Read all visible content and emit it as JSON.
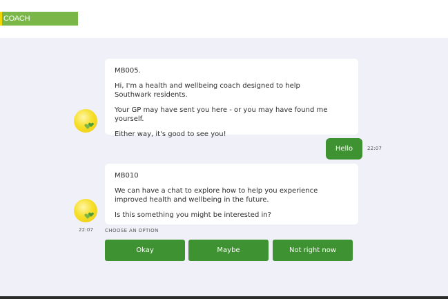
{
  "header": {
    "logo_text": "COACH"
  },
  "messages": [
    {
      "paragraphs": [
        "MB005.",
        "Hi, I'm a health and wellbeing coach designed to help Southwark residents.",
        "Your GP may have sent you here - or you may have found me yourself.",
        "Either way, it's good to see you!"
      ]
    },
    {
      "text": "Hello",
      "time": "22:07"
    },
    {
      "paragraphs": [
        "MB010",
        "We can have a chat to explore how to help you experience improved health and wellbeing in the future.",
        "Is this something you might be interested in?"
      ],
      "time": "22:07"
    }
  ],
  "options": {
    "label": "CHOOSE AN OPTION",
    "buttons": [
      "Okay",
      "Maybe",
      "Not right now"
    ]
  },
  "colors": {
    "brand_green": "#3f9231",
    "logo_green": "#7ab648",
    "logo_accent": "#f2d600",
    "background": "#f0f1f8"
  },
  "icons": {
    "avatar": "smiley-heart-icon"
  }
}
